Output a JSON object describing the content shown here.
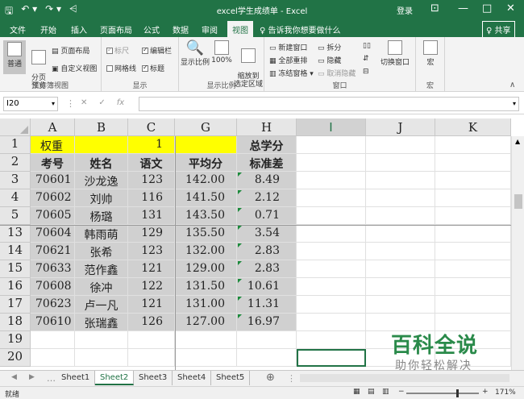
{
  "titlebar": {
    "save_icon": "save-icon",
    "undo_icon": "undo-icon",
    "redo_icon": "redo-icon",
    "title": "excel学生成绩单  -  Excel",
    "login": "登录",
    "min": "—",
    "max": "□",
    "close": "✕"
  },
  "menu": {
    "items": [
      "文件",
      "开始",
      "插入",
      "页面布局",
      "公式",
      "数据",
      "审阅",
      "视图"
    ],
    "active": "视图",
    "tellme": "♀ 告诉我你想要做什么",
    "share": "♀ 共享"
  },
  "ribbon": {
    "workbook_views": {
      "label": "工作簿视图",
      "normal": "普通",
      "page_break": "分页\n预览",
      "page_layout": "页面布局",
      "custom_views": "自定义视图"
    },
    "show": {
      "label": "显示",
      "ruler": "标尺",
      "gridlines": "网格线",
      "formula_bar": "编辑栏",
      "headings": "标题"
    },
    "zoom": {
      "label": "显示比例",
      "zoom": "显示比例",
      "hundred": "100%",
      "zoom_selection": "缩放到\n选定区域"
    },
    "window": {
      "label": "窗口",
      "new_window": "新建窗口",
      "arrange_all": "全部重排",
      "freeze": "冻结窗格 ▾",
      "split": "拆分",
      "hide": "隐藏",
      "unhide": "取消隐藏",
      "switch": "切换窗口"
    },
    "macros": {
      "label": "宏",
      "macros": "宏"
    }
  },
  "formula_bar": {
    "namebox": "I20",
    "cancel": "✕",
    "enter": "✓",
    "fx": "fx",
    "value": ""
  },
  "columns": [
    "A",
    "B",
    "C",
    "G",
    "H",
    "I",
    "J",
    "K"
  ],
  "rows": [
    {
      "n": "1",
      "cells": [
        "权重",
        "",
        "1",
        "",
        "总学分"
      ]
    },
    {
      "n": "2",
      "cells": [
        "考号",
        "姓名",
        "语文",
        "平均分",
        "标准差"
      ]
    },
    {
      "n": "3",
      "cells": [
        "70601",
        "沙龙逸",
        "123",
        "142.00",
        "8.49"
      ]
    },
    {
      "n": "4",
      "cells": [
        "70602",
        "刘帅",
        "116",
        "141.50",
        "2.12"
      ]
    },
    {
      "n": "5",
      "cells": [
        "70605",
        "杨璐",
        "131",
        "143.50",
        "0.71"
      ]
    },
    {
      "n": "13",
      "cells": [
        "70604",
        "韩雨萌",
        "129",
        "135.50",
        "3.54"
      ]
    },
    {
      "n": "14",
      "cells": [
        "70621",
        "张希",
        "123",
        "132.00",
        "2.83"
      ]
    },
    {
      "n": "15",
      "cells": [
        "70633",
        "范作鑫",
        "121",
        "129.00",
        "2.83"
      ]
    },
    {
      "n": "16",
      "cells": [
        "70608",
        "徐冲",
        "122",
        "131.50",
        "10.61"
      ]
    },
    {
      "n": "17",
      "cells": [
        "70623",
        "卢一凡",
        "121",
        "131.00",
        "11.31"
      ]
    },
    {
      "n": "18",
      "cells": [
        "70610",
        "张瑞鑫",
        "126",
        "127.00",
        "16.97"
      ]
    },
    {
      "n": "19",
      "cells": [
        "",
        "",
        "",
        "",
        ""
      ]
    },
    {
      "n": "20",
      "cells": [
        "",
        "",
        "",
        "",
        ""
      ]
    }
  ],
  "sheets": {
    "tabs": [
      "Sheet1",
      "Sheet2",
      "Sheet3",
      "Sheet4",
      "Sheet5"
    ],
    "active": "Sheet2",
    "add": "⊕"
  },
  "status": {
    "ready": "就绪",
    "zoom": "171%"
  },
  "watermark": {
    "line1": "百科全说",
    "line2": "助你轻松解决"
  },
  "colors": {
    "excel_green": "#217346",
    "yellow": "#ffff00",
    "gray": "#d0d0d0"
  }
}
